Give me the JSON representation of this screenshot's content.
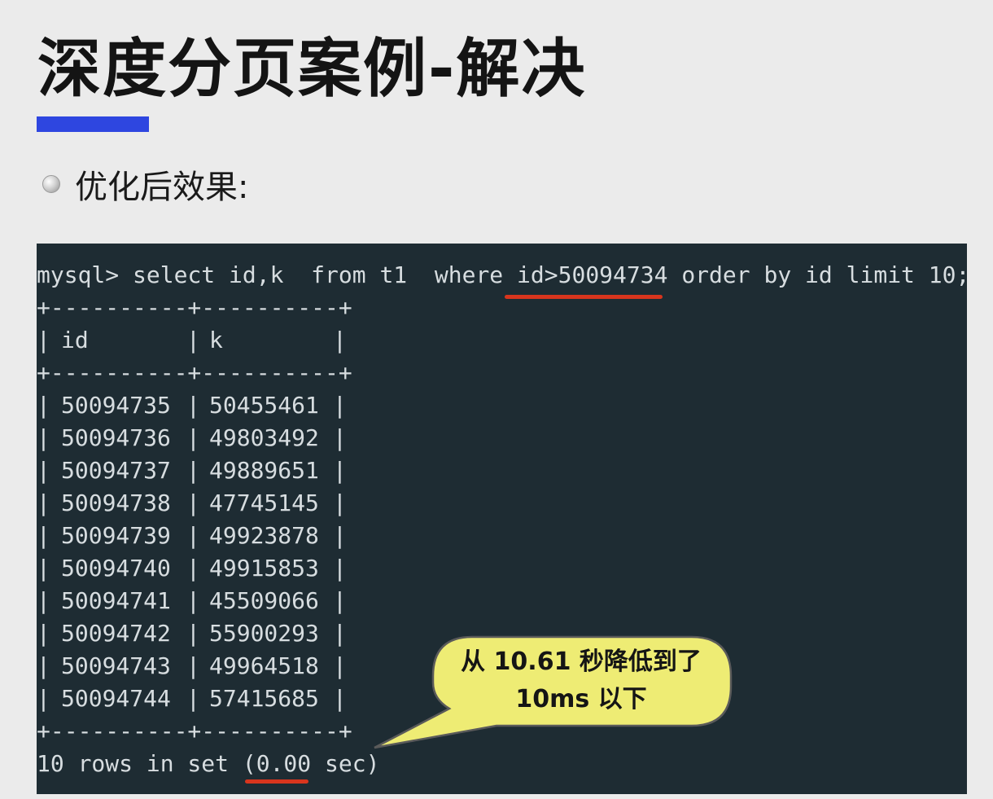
{
  "slide": {
    "title": "深度分页案例-解决",
    "bullet": "优化后效果:"
  },
  "terminal": {
    "query": {
      "prompt": "mysql>",
      "sql_before": "select id,k  from t1  where ",
      "sql_highlight": "id>50094734",
      "sql_after": " order by id limit 10;"
    },
    "border_line": "+----------+----------+",
    "headers": [
      "id",
      "k"
    ],
    "rows": [
      [
        "50094735",
        "50455461"
      ],
      [
        "50094736",
        "49803492"
      ],
      [
        "50094737",
        "49889651"
      ],
      [
        "50094738",
        "47745145"
      ],
      [
        "50094739",
        "49923878"
      ],
      [
        "50094740",
        "49915853"
      ],
      [
        "50094741",
        "45509066"
      ],
      [
        "50094742",
        "55900293"
      ],
      [
        "50094743",
        "49964518"
      ],
      [
        "50094744",
        "57415685"
      ]
    ],
    "result": {
      "prefix": "10 rows in set (",
      "time": "0.00",
      "suffix": " sec)"
    }
  },
  "callout": {
    "line1": "从 10.61 秒降低到了",
    "line2": "10ms 以下"
  },
  "colors": {
    "accent_bar": "#2e46e0",
    "terminal_bg": "#1e2c33",
    "terminal_text": "#d7dde0",
    "underline": "#d8351d",
    "callout_fill": "#eeec74"
  }
}
